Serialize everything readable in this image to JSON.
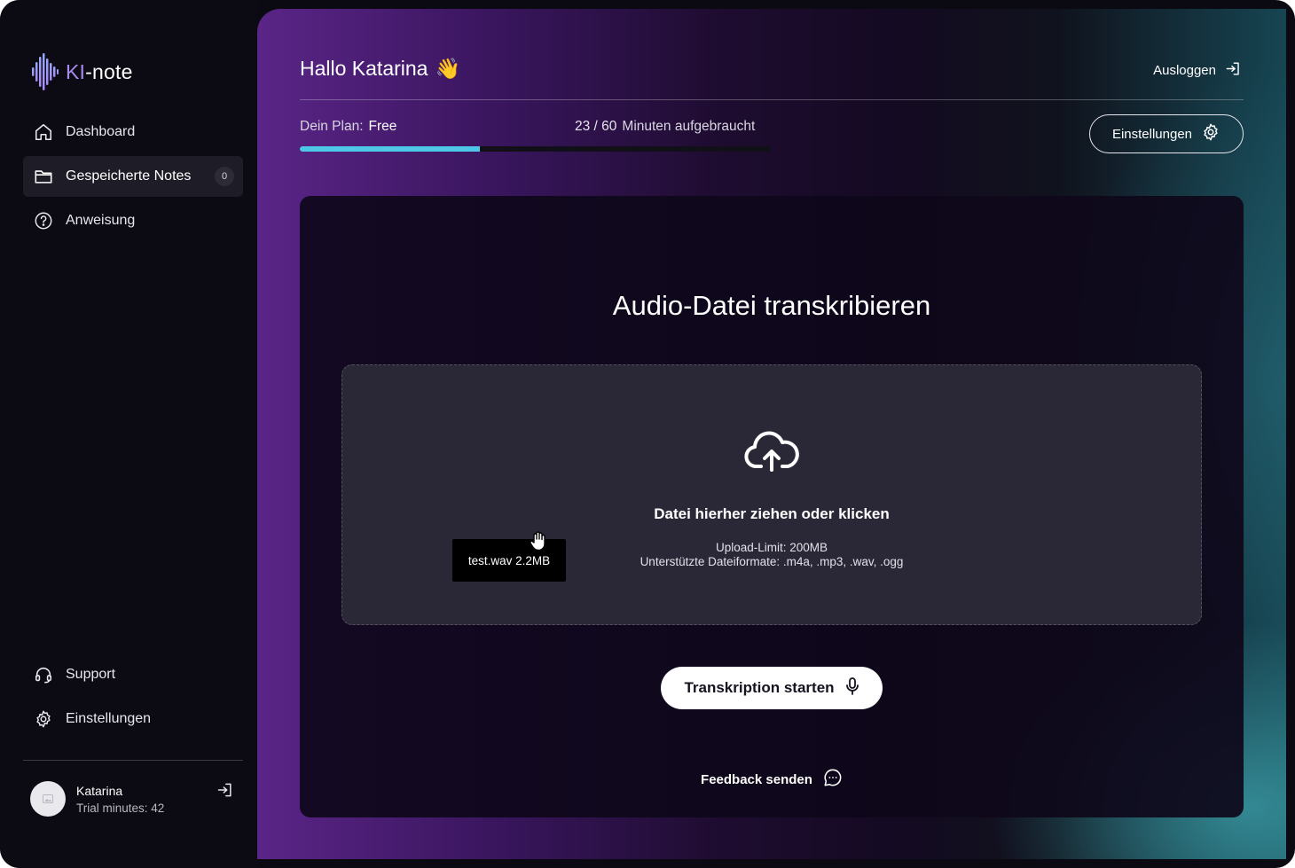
{
  "app": {
    "logo_accent": "KI",
    "logo_rest": "-note"
  },
  "sidebar": {
    "items": [
      {
        "label": "Dashboard",
        "icon": "home-icon"
      },
      {
        "label": "Gespeicherte Notes",
        "icon": "folder-icon",
        "badge": "0"
      },
      {
        "label": "Anweisung",
        "icon": "help-circle-icon"
      }
    ],
    "bottom_items": [
      {
        "label": "Support",
        "icon": "headset-icon"
      },
      {
        "label": "Einstellungen",
        "icon": "gear-icon"
      }
    ],
    "user": {
      "name": "Katarina",
      "subtitle": "Trial minutes: 42"
    }
  },
  "header": {
    "greeting": "Hallo Katarina",
    "greeting_emoji": "👋",
    "logout_label": "Ausloggen",
    "settings_label": "Einstellungen",
    "plan_label": "Dein Plan:",
    "plan_value": "Free",
    "usage_count": "23 / 60",
    "usage_text": "Minuten aufgebraucht",
    "usage_fraction": 0.383
  },
  "upload": {
    "title": "Audio-Datei transkribieren",
    "dropzone_title": "Datei hierher ziehen oder klicken",
    "limit": "Upload-Limit: 200MB",
    "formats": "Unterstützte Dateiformate: .m4a, .mp3, .wav, .ogg",
    "dragged_file": "test.wav 2.2MB",
    "start_label": "Transkription starten",
    "feedback_label": "Feedback senden"
  },
  "colors": {
    "accent_progress": "#4fc8e8",
    "logo_accent": "#a98bf0",
    "sidebar_bg": "#0c0b13"
  }
}
